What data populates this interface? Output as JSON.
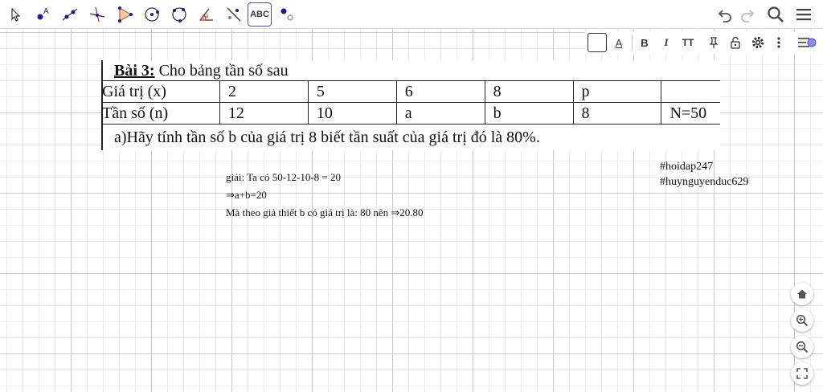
{
  "toolbar": {
    "tools": [
      {
        "name": "move-tool-icon"
      },
      {
        "name": "point-tool-icon"
      },
      {
        "name": "line-tool-icon"
      },
      {
        "name": "perpendicular-tool-icon"
      },
      {
        "name": "polygon-tool-icon"
      },
      {
        "name": "circle-tool-icon"
      },
      {
        "name": "circle-three-points-tool-icon"
      },
      {
        "name": "angle-tool-icon"
      },
      {
        "name": "reflect-tool-icon"
      },
      {
        "name": "text-tool",
        "label": "ABC"
      },
      {
        "name": "slider-tool-icon"
      }
    ]
  },
  "stylebar": {
    "text_color_label": "A",
    "bold_label": "B",
    "italic_label": "I",
    "size_label": "TT"
  },
  "exercise": {
    "title_bold": "Bài 3:",
    "title_rest": " Cho bảng tần số sau",
    "table": [
      [
        "Giá trị (x)",
        "2",
        "5",
        "6",
        "8",
        "p",
        ""
      ],
      [
        "Tần số (n)",
        "12",
        "10",
        "a",
        "b",
        "8",
        "N=50"
      ]
    ],
    "question": "a)Hãy tính tần số b của giá trị 8 biết tần suất của giá trị đó là 80%."
  },
  "solution": {
    "line1": "giải:   Ta có 50-12-10-8 = 20",
    "line2": "⇒a+b=20",
    "line3": "Mà theo giả thiết b có giá trị là: 80  nên ⇒20.80"
  },
  "tags": {
    "tag1": "#hoidap247",
    "tag2": "#huynguyenduc629"
  },
  "colors": {
    "accent": "#4a4ad0",
    "point": "#1a1aa0",
    "grid_major": "#c8c8c8",
    "grid_minor": "#ececec"
  }
}
